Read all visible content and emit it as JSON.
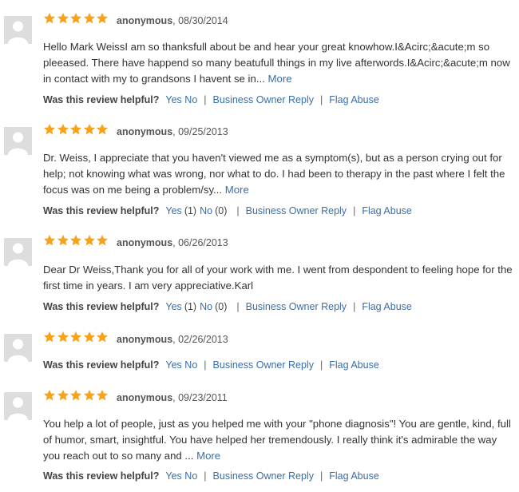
{
  "colors": {
    "star": "#f7a21b",
    "link": "#3a6ea8",
    "avatar_bg": "#dddddd"
  },
  "reviews": [
    {
      "stars": 5,
      "author": "anonymous",
      "date": "08/30/2014",
      "text": "Hello Mark WeissI am so thanksfull about be and hear your great knowhow.I&Acirc;&acute;m so pleeased. There have happend so many beatufull things in my live afterwords.I&Acirc;&acute;m now in contact with my to grandsons I havent se in...",
      "more": "More",
      "question": "Was this review helpful?",
      "yes": "Yes",
      "yes_count": "",
      "no": "No",
      "no_count": "",
      "owner_reply": "Business Owner Reply",
      "flag": "Flag Abuse"
    },
    {
      "stars": 5,
      "author": "anonymous",
      "date": "09/25/2013",
      "text": "Dr. Weiss, I appreciate that you haven't viewed me as a symptom(s), but as a person crying out for help; not knowing what was wrong, nor what to do. I had been to therapy in the past where I felt the focus was on me being a problem/sy...",
      "more": "More",
      "question": "Was this review helpful?",
      "yes": "Yes",
      "yes_count": "(1)",
      "no": "No",
      "no_count": "(0)",
      "owner_reply": "Business Owner Reply",
      "flag": "Flag Abuse"
    },
    {
      "stars": 5,
      "author": "anonymous",
      "date": "06/26/2013",
      "text": "Dear Dr Weiss,Thank you for all of your work with me. I went from despondent to feeling hope for the first time in years. I am very appreciative.Karl",
      "more": "",
      "question": "Was this review helpful?",
      "yes": "Yes",
      "yes_count": "(1)",
      "no": "No",
      "no_count": "(0)",
      "owner_reply": "Business Owner Reply",
      "flag": "Flag Abuse"
    },
    {
      "stars": 5,
      "author": "anonymous",
      "date": "02/26/2013",
      "text": "",
      "more": "",
      "question": "Was this review helpful?",
      "yes": "Yes",
      "yes_count": "",
      "no": "No",
      "no_count": "",
      "owner_reply": "Business Owner Reply",
      "flag": "Flag Abuse"
    },
    {
      "stars": 5,
      "author": "anonymous",
      "date": "09/23/2011",
      "text": "You help a lot of people, just as you helped me with your \"phone diagnosis\"! You are gentle, kind, full of humor, smart, insightful. You have helped her tremendously. I really think it's admirable the way you reach out to so many and ...",
      "more": "More",
      "question": "Was this review helpful?",
      "yes": "Yes",
      "yes_count": "",
      "no": "No",
      "no_count": "",
      "owner_reply": "Business Owner Reply",
      "flag": "Flag Abuse"
    }
  ]
}
